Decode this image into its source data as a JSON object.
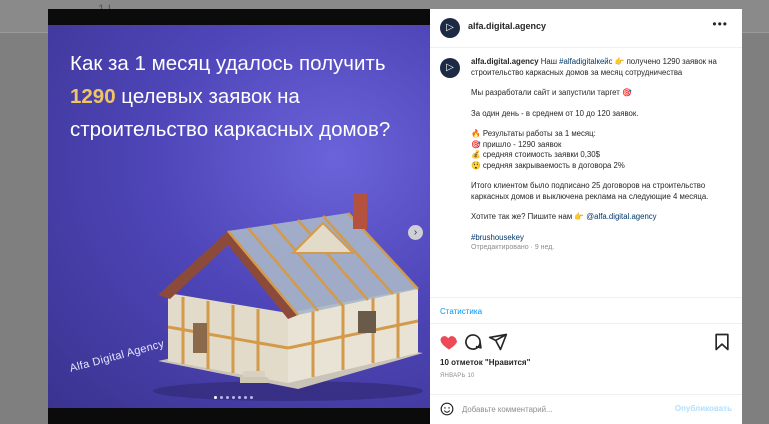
{
  "background": {
    "glyph_left": "1 l",
    "glyph_right": ""
  },
  "slide": {
    "headline_part1": "Как за 1 месяц удалось получить ",
    "headline_highlight": "1290",
    "headline_part2": " целевых заявок на строительство каркасных домов?",
    "brand": "Alfa Digital Agency",
    "slide_count": 7,
    "active_index": 0,
    "colors": {
      "highlight": "#f2c564",
      "bg": "#4e45b8"
    }
  },
  "header": {
    "username": "alfa.digital.agency",
    "more": "•••"
  },
  "caption": {
    "username": "alfa.digital.agency",
    "line1_a": "Наш ",
    "hashtag1": "#alfadigitalкейс",
    "line1_b": " 👉 получено 1290 заявок на строительство каркасных домов за месяц сотрудничества",
    "p1": "Мы разработали сайт и запустили таргет 🎯",
    "p2": "За один день - в среднем от 10 до 120 заявок.",
    "results_title": "🔥 Результаты работы за 1 месяц:",
    "r1": "🎯 пришло - 1290 заявок",
    "r2": "💰 средняя стоимость заявки 0,30$",
    "r3": "😲 средняя закрываемость в договора 2%",
    "p3": "Итого клиентом было подписано 25 договоров на строительство каркасных домов и выключена реклама на следующие 4 месяца.",
    "p4_a": "Хотите так же? Пишите нам 👉 ",
    "mention": "@alfa.digital.agency",
    "hashtag2": "#brushousekey",
    "edited": "Отредактировано · 9 нед."
  },
  "stats_link": "Статистика",
  "likes": "10 отметок \"Нравится\"",
  "date": "ЯНВАРЬ 10",
  "comment": {
    "placeholder": "Добавьте комментарий...",
    "post": "Опубликовать"
  }
}
